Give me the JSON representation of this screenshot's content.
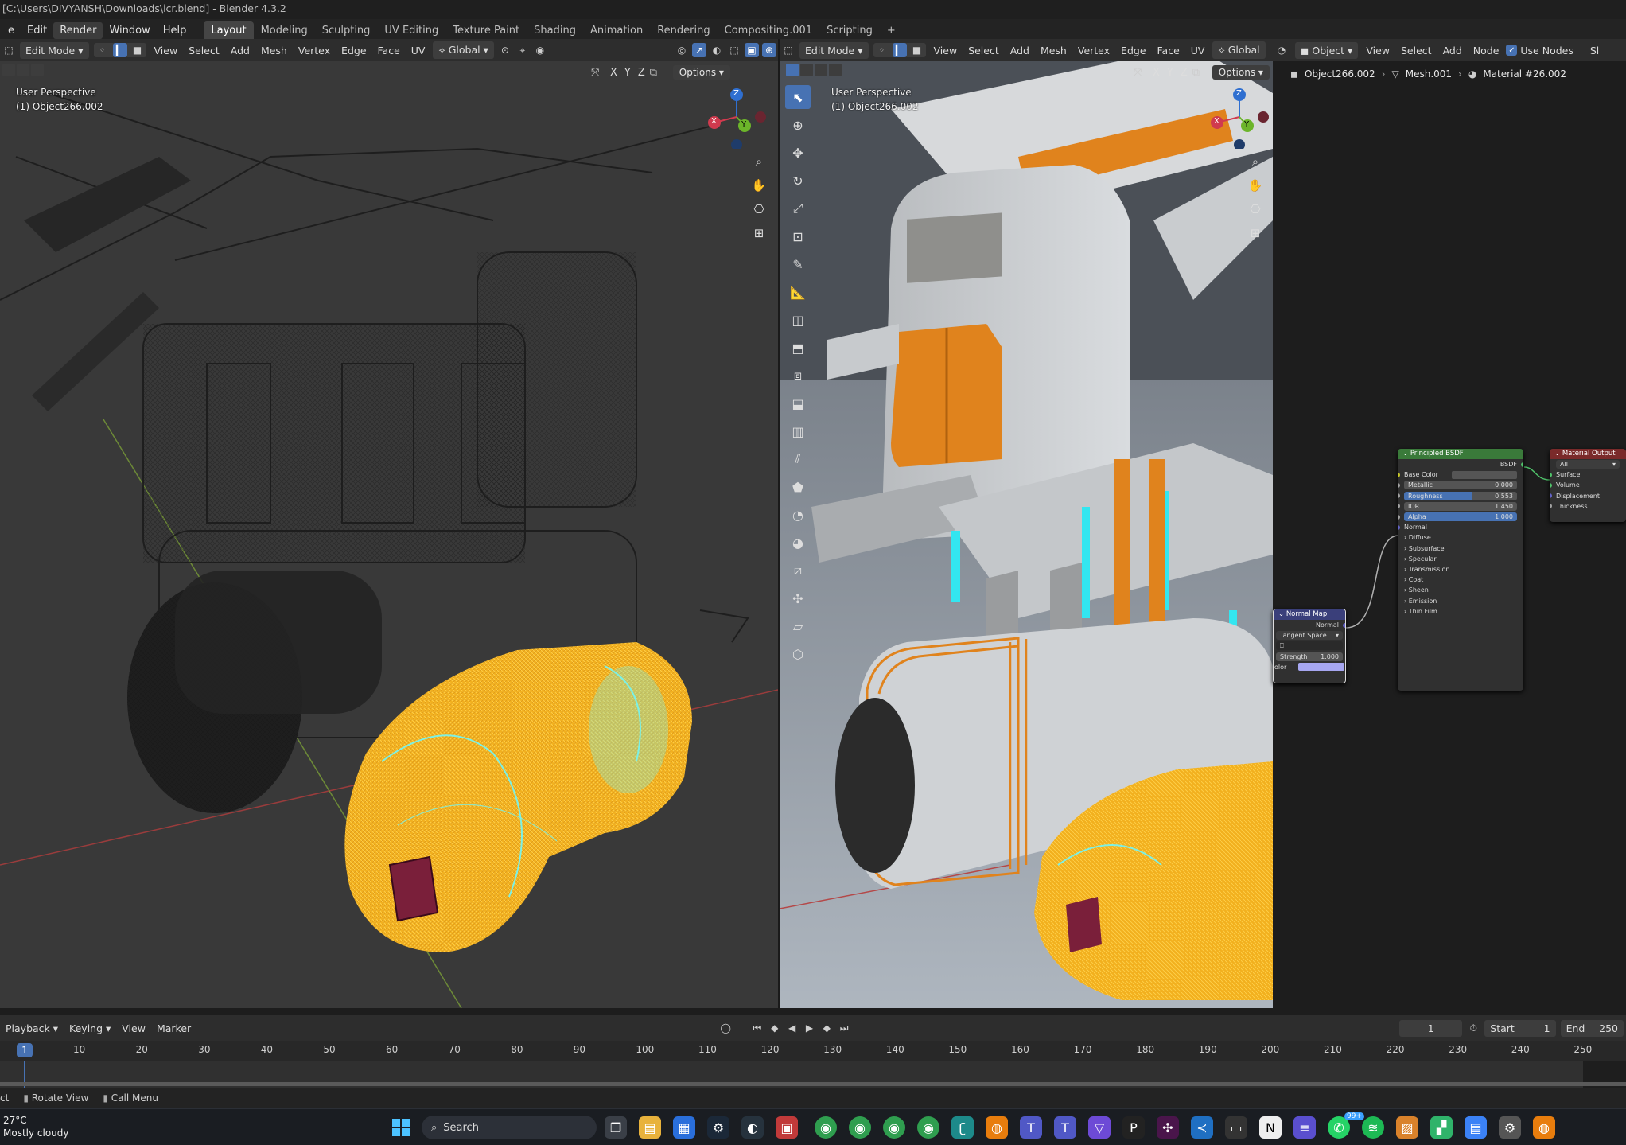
{
  "window": {
    "title": "[C:\\Users\\DIVYANSH\\Downloads\\icr.blend] - Blender 4.3.2"
  },
  "menu": {
    "items": [
      "e",
      "Edit",
      "Render",
      "Window",
      "Help"
    ],
    "workspaces": [
      "Layout",
      "Modeling",
      "Sculpting",
      "UV Editing",
      "Texture Paint",
      "Shading",
      "Animation",
      "Rendering",
      "Compositing.001",
      "Scripting",
      "+"
    ]
  },
  "left_view": {
    "mode": "Edit Mode",
    "menus": [
      "View",
      "Select",
      "Add",
      "Mesh",
      "Vertex",
      "Edge",
      "Face",
      "UV"
    ],
    "orientation": "Global",
    "options_label": "Options",
    "xyz": [
      "X",
      "Y",
      "Z"
    ],
    "perspective": "User Perspective",
    "object": "(1) Object266.002"
  },
  "right_view": {
    "mode": "Edit Mode",
    "menus": [
      "View",
      "Select",
      "Add",
      "Mesh",
      "Vertex",
      "Edge",
      "Face",
      "UV"
    ],
    "orientation": "Global",
    "options_label": "Options",
    "xyz": [
      "X",
      "Y",
      "Z"
    ],
    "perspective": "User Perspective",
    "object": "(1) Object266.002"
  },
  "gizmo": {
    "x": "X",
    "y": "Y",
    "z": "Z"
  },
  "node_editor": {
    "mode": "Object",
    "menus": [
      "View",
      "Select",
      "Add",
      "Node"
    ],
    "use_nodes": "Use Nodes",
    "slot": "Sl",
    "breadcrumb": [
      "Object266.002",
      "Mesh.001",
      "Material #26.002"
    ],
    "bsdf": {
      "title": "Principled BSDF",
      "output": "BSDF",
      "base_color": "Base Color",
      "metallic": {
        "label": "Metallic",
        "value": "0.000"
      },
      "roughness": {
        "label": "Roughness",
        "value": "0.553"
      },
      "ior": {
        "label": "IOR",
        "value": "1.450"
      },
      "alpha": {
        "label": "Alpha",
        "value": "1.000"
      },
      "normal": "Normal",
      "panels": [
        "Diffuse",
        "Subsurface",
        "Specular",
        "Transmission",
        "Coat",
        "Sheen",
        "Emission",
        "Thin Film"
      ]
    },
    "output_node": {
      "title": "Material Output",
      "target": "All",
      "inputs": [
        "Surface",
        "Volume",
        "Displacement",
        "Thickness"
      ]
    },
    "normal_map": {
      "title": "Normal Map",
      "output": "Normal",
      "space": "Tangent Space",
      "strength": {
        "label": "Strength",
        "value": "1.000"
      },
      "color": "olor"
    }
  },
  "timeline": {
    "menus": [
      "Playback",
      "Keying",
      "View",
      "Marker"
    ],
    "current_frame": "1",
    "start_label": "Start",
    "start_value": "1",
    "end_label": "End",
    "end_value": "250",
    "ruler": [
      "10",
      "20",
      "30",
      "40",
      "50",
      "60",
      "70",
      "80",
      "90",
      "100",
      "110",
      "120",
      "130",
      "140",
      "150",
      "160",
      "170",
      "180",
      "190",
      "200",
      "210",
      "220",
      "230",
      "240",
      "250"
    ],
    "playhead": "1"
  },
  "status": {
    "left": "ct",
    "rotate": "Rotate View",
    "menu": "Call Menu"
  },
  "taskbar": {
    "weather_temp": "27°C",
    "weather_desc": "Mostly cloudy",
    "search": "Search",
    "badge": "99+"
  }
}
